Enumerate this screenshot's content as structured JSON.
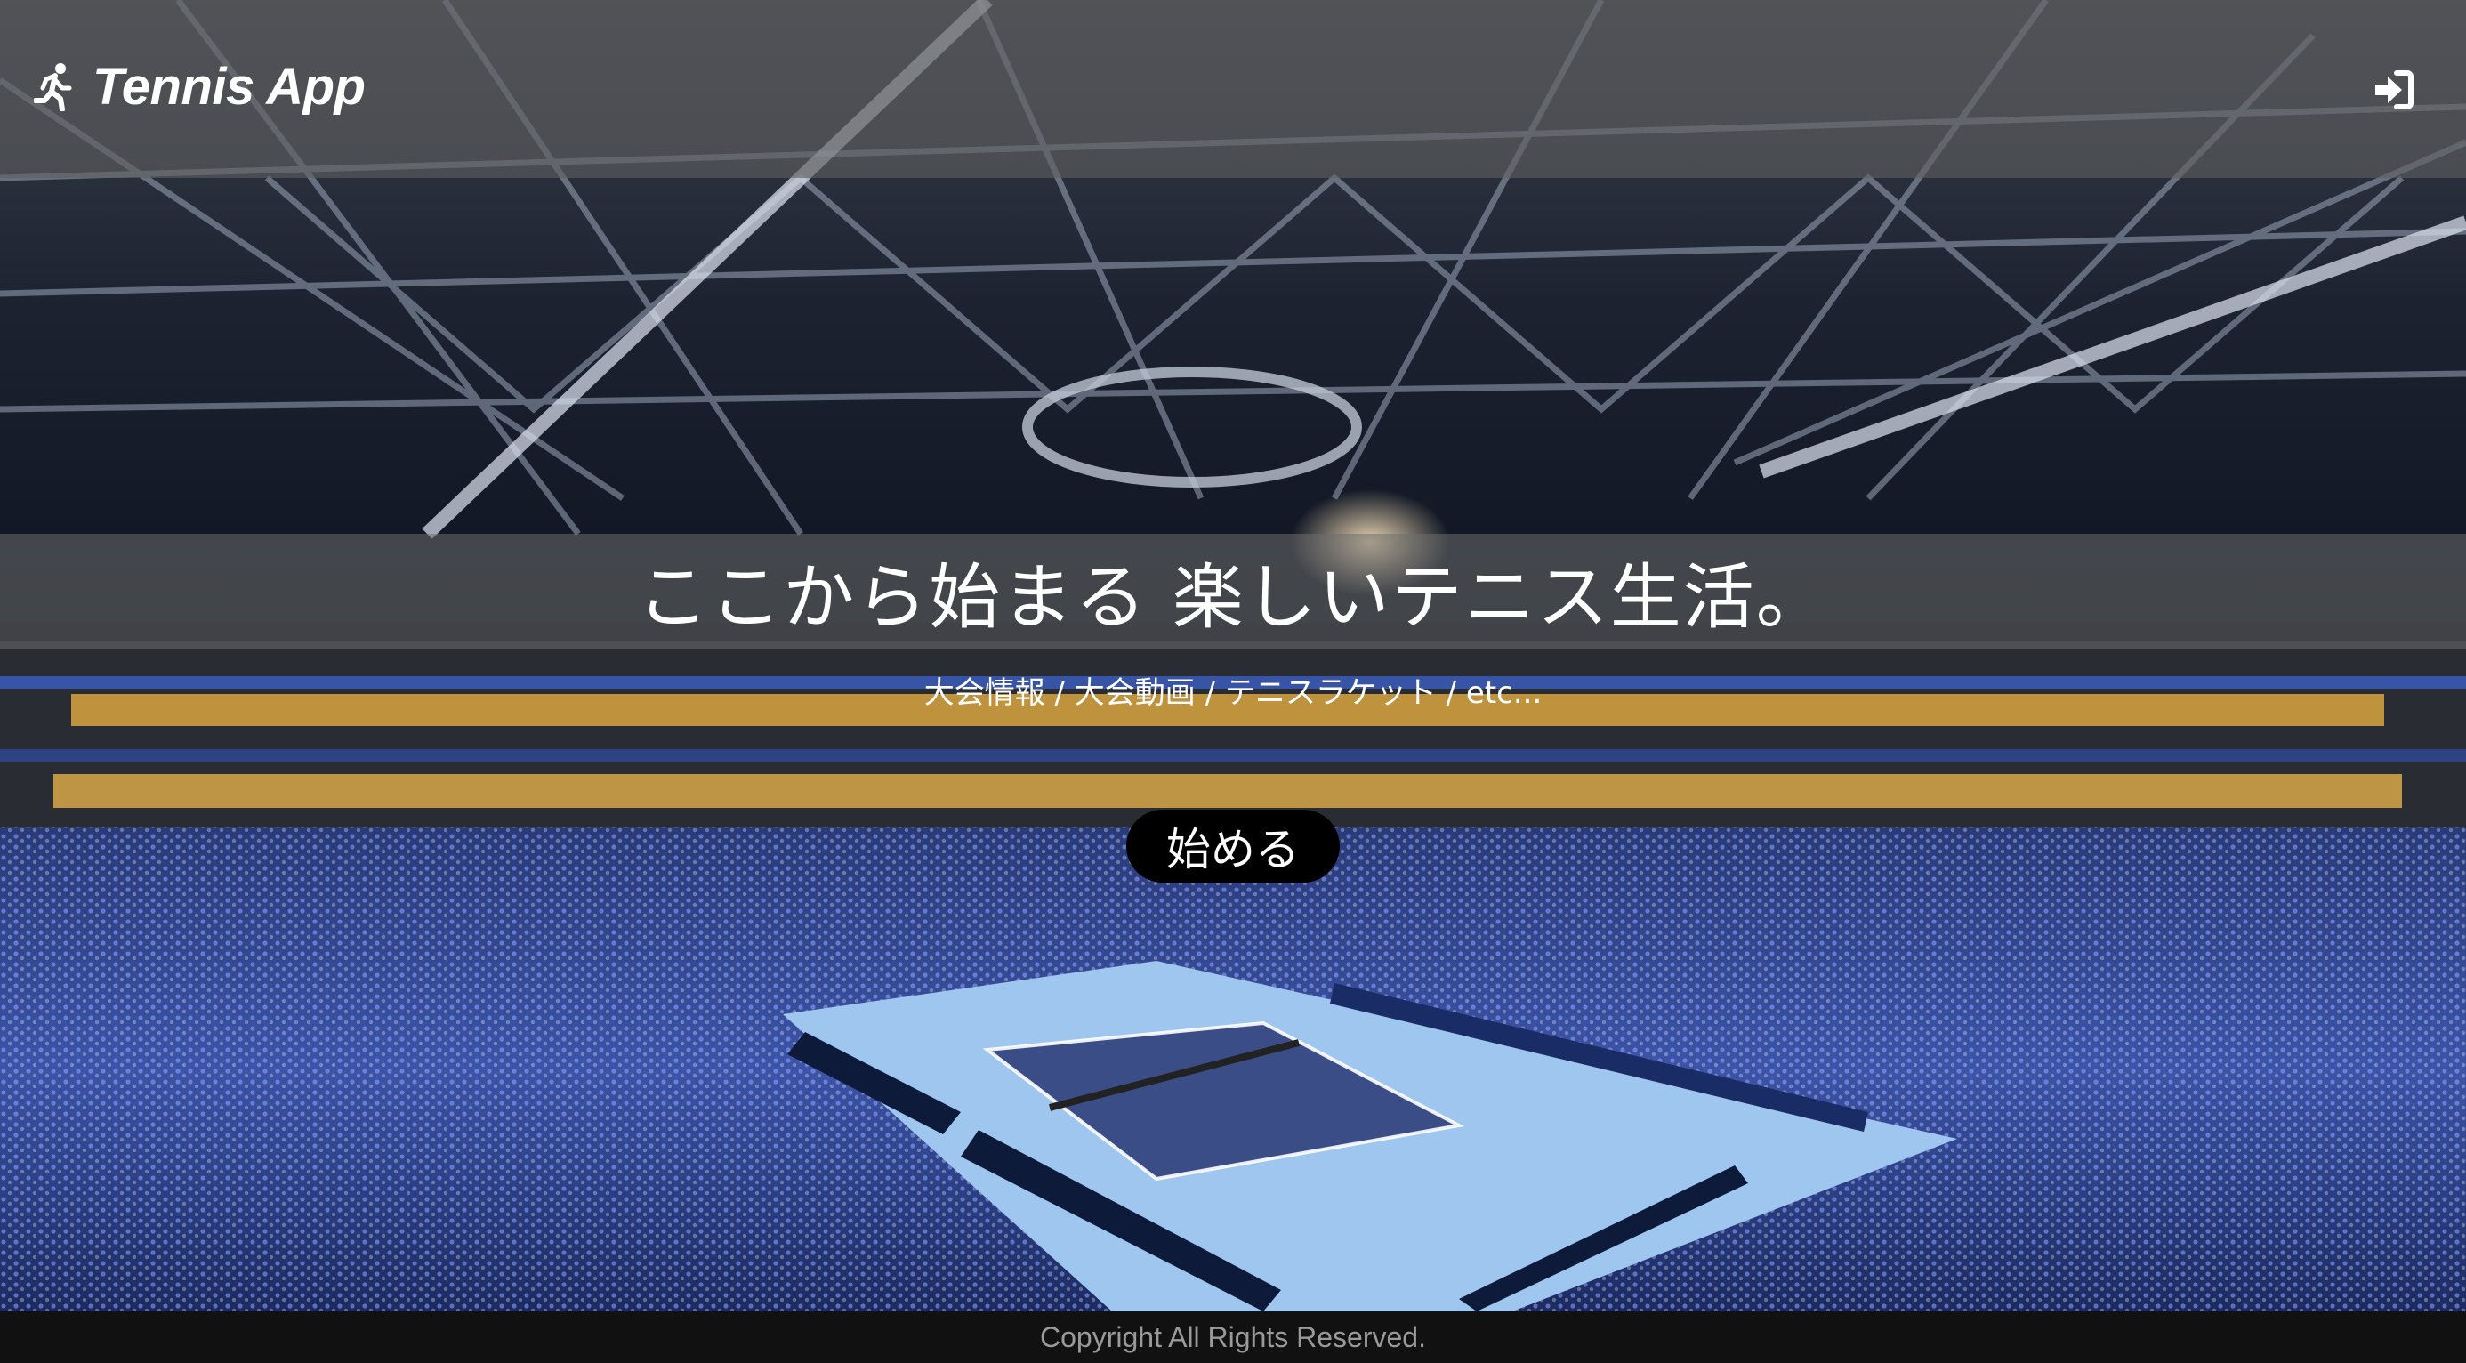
{
  "app": {
    "title": "Tennis App",
    "brand_icon": "running-person-icon"
  },
  "header": {
    "login_icon": "sign-in-icon"
  },
  "hero": {
    "background": "arena-tennis-court-photo",
    "headline": "ここから始まる 楽しいテニス生活。",
    "subtitle": "大会情報 / 大会動画 / テニスラケット / etc...",
    "cta_label": "始める"
  },
  "footer": {
    "copyright": "Copyright All Rights Reserved."
  },
  "colors": {
    "header_overlay": "#5f5f5f",
    "button_bg": "#000000",
    "court": "#9ec6ee",
    "text": "#ffffff",
    "footer_bg": "#111111"
  }
}
